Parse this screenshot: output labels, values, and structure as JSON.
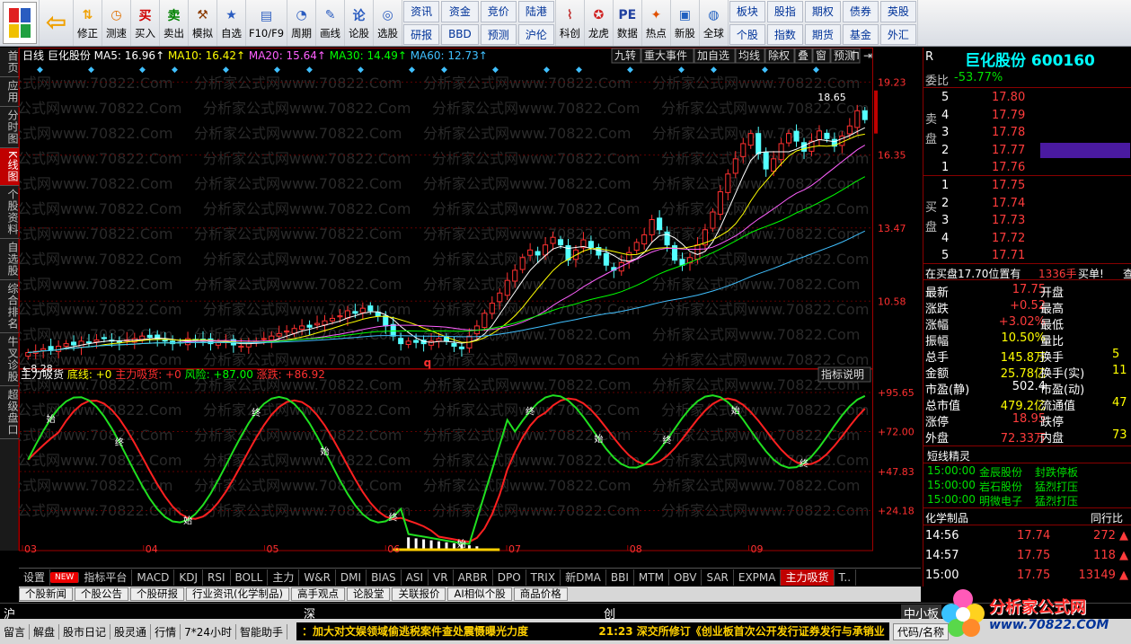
{
  "toolbar": {
    "big_buttons": [
      {
        "label": "",
        "icon": "logo-icon"
      },
      {
        "label": "",
        "icon": "back-arrow-icon"
      },
      {
        "label": "修正",
        "icon": "up-down-icon"
      },
      {
        "label": "测速",
        "icon": "clock-icon"
      },
      {
        "label": "买入",
        "icon": "buy-icon",
        "icon_text": "买"
      },
      {
        "label": "卖出",
        "icon": "sell-icon",
        "icon_text": "卖"
      },
      {
        "label": "模拟",
        "icon": "hammer-icon"
      },
      {
        "label": "自选",
        "icon": "star-icon"
      },
      {
        "label": "F10/F9",
        "icon": "f10-icon"
      },
      {
        "label": "周期",
        "icon": "period-icon"
      },
      {
        "label": "画线",
        "icon": "pen-icon"
      },
      {
        "label": "论股",
        "icon": "chat-icon",
        "icon_text": "论"
      },
      {
        "label": "选股",
        "icon": "select-icon"
      }
    ],
    "grid1": [
      [
        "资讯",
        "资金",
        "竞价",
        "陆港"
      ],
      [
        "研报",
        "BBD",
        "预测",
        "沪伦"
      ]
    ],
    "big2": [
      {
        "label": "科创",
        "icon": "chart-icon"
      },
      {
        "label": "龙虎",
        "icon": "dragon-icon"
      },
      {
        "label": "数据",
        "icon": "pe-icon",
        "icon_text": "PE"
      },
      {
        "label": "热点",
        "icon": "hot-icon"
      },
      {
        "label": "新股",
        "icon": "new-stock-icon"
      },
      {
        "label": "全球",
        "icon": "globe-icon"
      }
    ],
    "grid2": [
      [
        "板块",
        "股指",
        "期权",
        "债券",
        "英股"
      ],
      [
        "个股",
        "指数",
        "期货",
        "基金",
        "外汇"
      ]
    ]
  },
  "left_tabs": [
    "首页",
    "应用",
    "分时图",
    "K线图",
    "个股资料",
    "自选股",
    "综合排名",
    "牛叉诊股",
    "超级盘口"
  ],
  "left_tabs_active": 3,
  "header": {
    "period": "日线",
    "stock": "巨化股份",
    "ma": [
      {
        "label": "MA5: 16.96",
        "color": "#ffffff"
      },
      {
        "label": "MA10: 16.42",
        "color": "#ffff00"
      },
      {
        "label": "MA20: 15.64",
        "color": "#ff60ff"
      },
      {
        "label": "MA30: 14.49",
        "color": "#00ff00"
      },
      {
        "label": "MA60: 12.73",
        "color": "#40c0ff"
      }
    ],
    "right_buttons": [
      "九转",
      "重大事件",
      "加自选",
      "均线",
      "除权",
      "叠",
      "窗",
      "预测"
    ],
    "watermark": "分析家公式网www.70822.Com"
  },
  "chart_data": {
    "type": "candlestick",
    "price_axis": [
      19.23,
      16.35,
      13.47,
      10.58
    ],
    "indicator_axis": [
      95.65,
      72.0,
      47.83,
      24.18
    ],
    "x_ticks": [
      "03",
      "04",
      "05",
      "06",
      "07",
      "08",
      "09"
    ],
    "annotations": {
      "high": "18.65",
      "low": "8.28",
      "marker": "q"
    },
    "indicator": {
      "name": "主力吸货",
      "labels": [
        {
          "text": "底线: +0",
          "color": "#ffff00"
        },
        {
          "text": "主力吸货: +0",
          "color": "#ff3030"
        },
        {
          "text": "风险: +87.00",
          "color": "#00ff00"
        },
        {
          "text": "涨跌: +86.92",
          "color": "#ff3030"
        }
      ],
      "button": "指标说明",
      "signals": [
        "终",
        "始"
      ]
    },
    "closes": [
      8.55,
      8.6,
      8.7,
      8.65,
      8.8,
      8.9,
      8.85,
      9.0,
      8.95,
      9.05,
      9.1,
      9.0,
      8.95,
      9.05,
      9.1,
      9.2,
      9.15,
      9.1,
      9.0,
      8.9,
      8.95,
      9.1,
      9.05,
      9.0,
      8.9,
      8.95,
      9.0,
      8.85,
      8.8,
      8.9,
      9.0,
      9.1,
      9.2,
      9.3,
      9.4,
      9.5,
      9.6,
      9.55,
      9.7,
      9.8,
      9.9,
      10.0,
      10.2,
      10.1,
      10.3,
      10.2,
      10.0,
      9.6,
      9.2,
      8.9,
      9.0,
      8.95,
      8.9,
      9.0,
      9.1,
      9.0,
      8.8,
      8.7,
      9.2,
      9.6,
      10.1,
      10.5,
      10.9,
      11.4,
      11.8,
      12.3,
      12.6,
      12.4,
      12.8,
      13.1,
      12.8,
      12.2,
      12.6,
      13.0,
      12.7,
      12.4,
      12.0,
      11.8,
      12.1,
      12.5,
      12.9,
      13.2,
      13.8,
      13.4,
      12.8,
      12.2,
      12.0,
      12.3,
      12.8,
      13.4,
      14.1,
      14.9,
      15.6,
      16.2,
      16.8,
      17.2,
      16.4,
      15.8,
      16.2,
      16.8,
      17.2,
      16.9,
      16.5,
      16.9,
      17.3,
      17.0,
      16.7,
      17.1,
      17.5,
      18.1,
      17.75
    ]
  },
  "right_panel": {
    "flag": "R",
    "title": "巨化股份 600160",
    "weibi_label": "委比",
    "weibi": "-53.77%",
    "sell_side": "卖\n盘",
    "buy_side": "买\n盘",
    "asks": [
      {
        "lv": "5",
        "p": "17.80"
      },
      {
        "lv": "4",
        "p": "17.79"
      },
      {
        "lv": "3",
        "p": "17.78"
      },
      {
        "lv": "2",
        "p": "17.77"
      },
      {
        "lv": "1",
        "p": "17.76"
      }
    ],
    "bids": [
      {
        "lv": "1",
        "p": "17.75"
      },
      {
        "lv": "2",
        "p": "17.74"
      },
      {
        "lv": "3",
        "p": "17.73"
      },
      {
        "lv": "4",
        "p": "17.72"
      },
      {
        "lv": "5",
        "p": "17.71"
      }
    ],
    "notice": "在买盘17.70位置有",
    "notice_vol": "1336手",
    "notice_tag": "买单!",
    "notice_btn": "查",
    "stats": [
      {
        "l": "最新",
        "v": "17.75",
        "c": "red",
        "l2": "开盘",
        "v2": ""
      },
      {
        "l": "涨跌",
        "v": "+0.52",
        "c": "red",
        "l2": "最高",
        "v2": ""
      },
      {
        "l": "涨幅",
        "v": "+3.02%",
        "c": "red",
        "l2": "最低",
        "v2": ""
      },
      {
        "l": "振幅",
        "v": "10.50%",
        "c": "yel",
        "l2": "量比",
        "v2": ""
      },
      {
        "l": "总手",
        "v": "145.8万",
        "c": "yel",
        "l2": "换手",
        "v2": "5"
      },
      {
        "l": "金额",
        "v": "25.78亿",
        "c": "yel",
        "l2": "换手(实)",
        "v2": "11"
      },
      {
        "l": "市盈(静)",
        "v": "502.4",
        "c": "wht",
        "l2": "市盈(动)",
        "v2": ""
      },
      {
        "l": "总市值",
        "v": "479.2亿",
        "c": "yel",
        "l2": "流通值",
        "v2": "47"
      },
      {
        "l": "涨停",
        "v": "18.95",
        "c": "red",
        "l2": "跌停",
        "v2": ""
      },
      {
        "l": "外盘",
        "v": "72.33万",
        "c": "red",
        "l2": "内盘",
        "v2": "73"
      }
    ],
    "elf_title": "短线精灵",
    "elf": [
      {
        "t": "15:00:00",
        "s": "金辰股份",
        "e": "封跌停板"
      },
      {
        "t": "15:00:00",
        "s": "岩石股份",
        "e": "猛烈打压"
      },
      {
        "t": "15:00:00",
        "s": "明微电子",
        "e": "猛烈打压"
      }
    ],
    "ticks_title": "化学制品",
    "ticks_btn": "同行比",
    "ticks": [
      {
        "t": "14:56",
        "p": "17.74",
        "v": "272"
      },
      {
        "t": "14:57",
        "p": "17.75",
        "v": "118"
      },
      {
        "t": "15:00",
        "p": "17.75",
        "v": "13149"
      }
    ]
  },
  "indicator_tabs": [
    "设置",
    "NEW",
    "指标平台",
    "MACD",
    "KDJ",
    "RSI",
    "BOLL",
    "主力",
    "W&R",
    "DMI",
    "BIAS",
    "ASI",
    "VR",
    "ARBR",
    "DPO",
    "TRIX",
    "新DMA",
    "BBI",
    "MTM",
    "OBV",
    "SAR",
    "EXPMA",
    "主力吸货",
    "T.."
  ],
  "indicator_tabs_active": 22,
  "news_tabs": [
    "个股新闻",
    "个股公告",
    "个股研报",
    "行业资讯(化学制品)",
    "高手观点",
    "论股堂",
    "关联报价",
    "AI相似个股",
    "商品价格"
  ],
  "index_bar": {
    "sh": "沪",
    "sz": "深",
    "cy": "创",
    "zxb": "中小板"
  },
  "status_bar": {
    "items": [
      "留言",
      "解盘",
      "股市日记",
      "股灵通",
      "行情",
      "7*24小时",
      "智能助手"
    ],
    "news1": "加大对文娱领域偷逃税案件查处震慑曝光力度",
    "time": "21:23",
    "news2": "深交所修订《创业板首次公开发行证券发行与承销业",
    "code_btn": "代码/名称",
    "brand": "分析家公式网",
    "brand_url": "www.70822.COM"
  }
}
